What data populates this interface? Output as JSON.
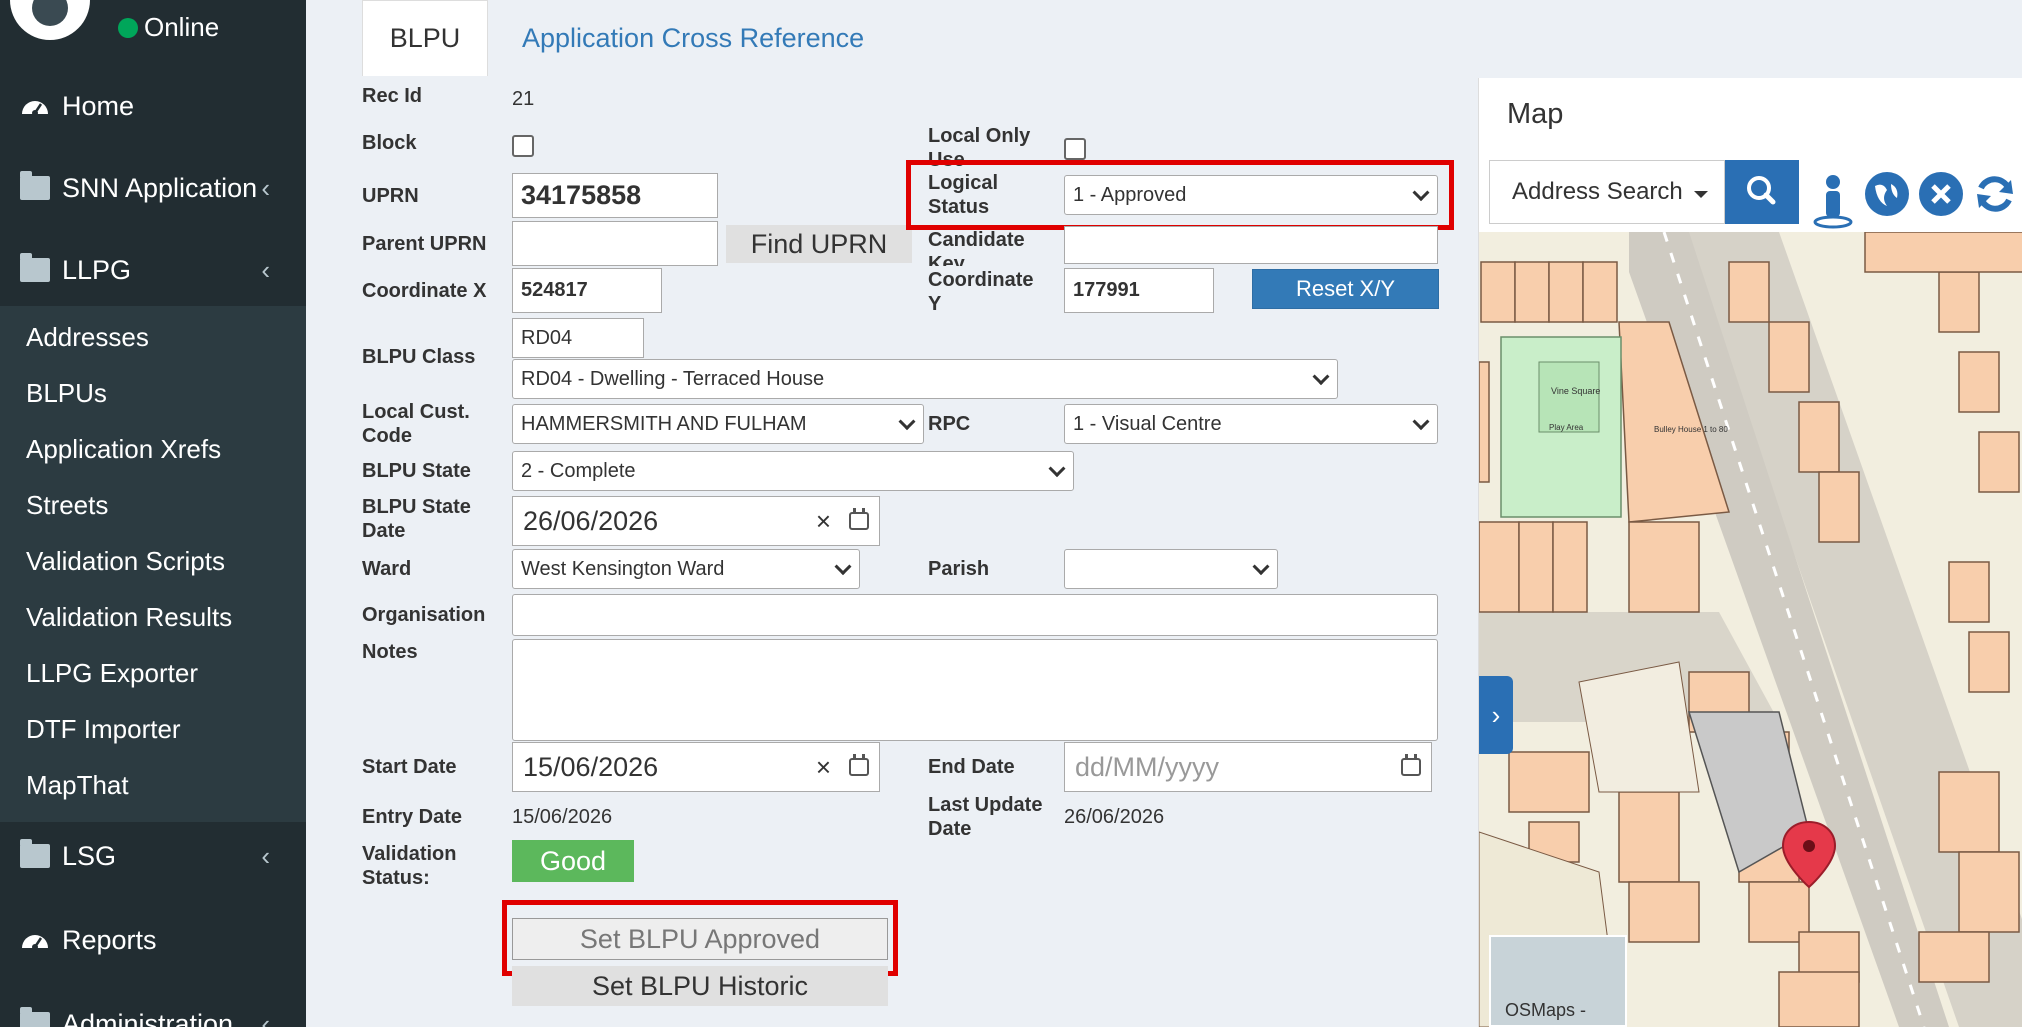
{
  "sidebar": {
    "status": "Online",
    "menu": {
      "home": "Home",
      "snn_application": "SNN Application",
      "llpg": "LLPG",
      "lsg": "LSG",
      "reports": "Reports",
      "administration": "Administration"
    },
    "llpg_items": [
      "Addresses",
      "BLPUs",
      "Application Xrefs",
      "Streets",
      "Validation Scripts",
      "Validation Results",
      "LLPG Exporter",
      "DTF Importer",
      "MapThat"
    ]
  },
  "tabs": {
    "blpu": "BLPU",
    "app_xref": "Application Cross Reference"
  },
  "form": {
    "labels": {
      "rec_id": "Rec Id",
      "block": "Block",
      "uprn": "UPRN",
      "parent_uprn": "Parent UPRN",
      "coordinate_x": "Coordinate X",
      "blpu_class": "BLPU Class",
      "local_cust_code": "Local Cust. Code",
      "blpu_state": "BLPU State",
      "blpu_state_date": "BLPU State Date",
      "ward": "Ward",
      "organisation": "Organisation",
      "notes": "Notes",
      "start_date": "Start Date",
      "entry_date": "Entry Date",
      "validation_status": "Validation Status:",
      "local_only_use": "Local Only Use",
      "logical_status": "Logical Status",
      "candidate_key": "Candidate Key",
      "coordinate_y": "Coordinate Y",
      "rpc": "RPC",
      "parish": "Parish",
      "end_date": "End Date",
      "last_update_date": "Last Update Date"
    },
    "values": {
      "rec_id": "21",
      "uprn": "34175858",
      "parent_uprn": "",
      "coordinate_x": "524817",
      "coordinate_y": "177991",
      "blpu_class_code": "RD04",
      "blpu_class_select": "RD04 - Dwelling - Terraced House",
      "local_cust_code": "HAMMERSMITH AND FULHAM",
      "rpc": "1 - Visual Centre",
      "blpu_state": "2 - Complete",
      "blpu_state_date": "26/06/2026",
      "ward": "West Kensington Ward",
      "parish": "",
      "logical_status": "1 - Approved",
      "candidate_key": "",
      "organisation": "",
      "notes": "",
      "start_date": "15/06/2026",
      "end_date_placeholder": "dd/MM/yyyy",
      "entry_date": "15/06/2026",
      "last_update_date": "26/06/2026",
      "validation_status": "Good"
    },
    "buttons": {
      "find_uprn": "Find UPRN",
      "reset_xy": "Reset X/Y",
      "set_approved": "Set BLPU Approved",
      "set_historic": "Set BLPU Historic"
    },
    "clear_glyph": "×"
  },
  "map": {
    "title": "Map",
    "search_label": "Address Search",
    "overview_label": "OSMaps -",
    "collapse_glyph": "›",
    "labels": {
      "vine_square": "Vine Square",
      "play_area": "Play Area",
      "bulley_house": "Bulley House 1 to 80"
    }
  },
  "colors": {
    "sidebar_bg": "#222d32",
    "accent_blue": "#337ab7",
    "highlight_red": "#e00000",
    "good_green": "#5cb85c",
    "online_green": "#00a65a"
  }
}
